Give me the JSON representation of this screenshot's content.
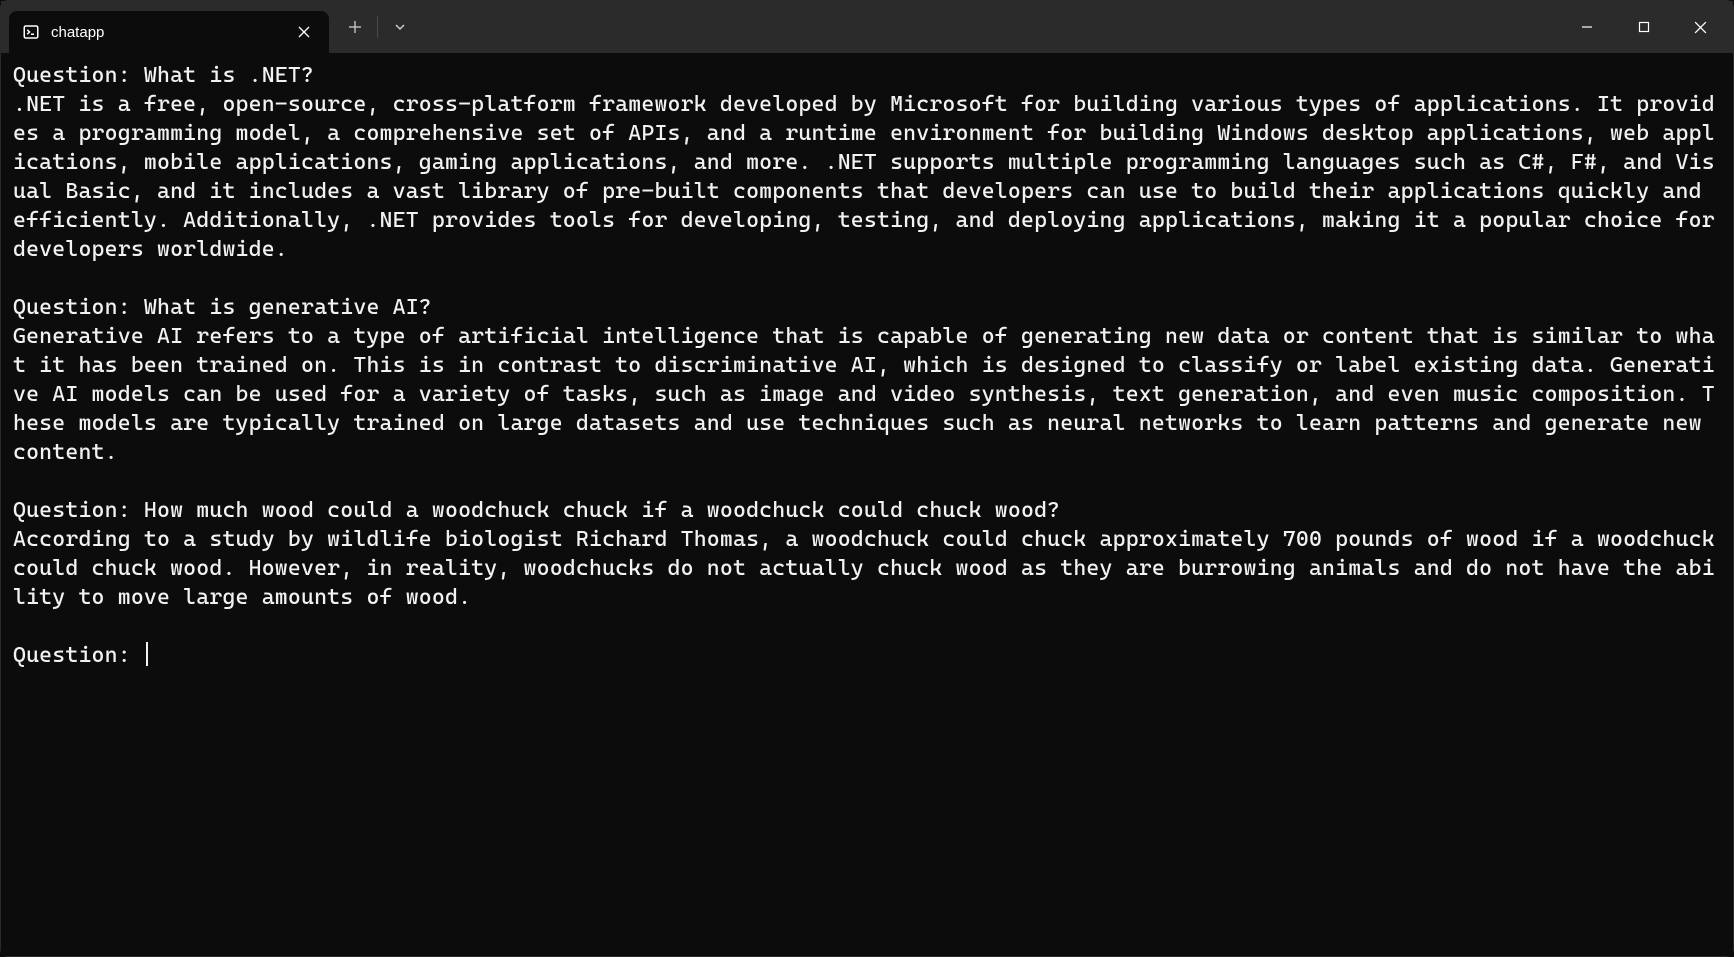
{
  "window": {
    "tab_title": "chatapp"
  },
  "terminal": {
    "qa": [
      {
        "question_label": "Question: ",
        "question": "What is .NET?",
        "answer": ".NET is a free, open-source, cross-platform framework developed by Microsoft for building various types of applications. It provides a programming model, a comprehensive set of APIs, and a runtime environment for building Windows desktop applications, web applications, mobile applications, gaming applications, and more. .NET supports multiple programming languages such as C#, F#, and Visual Basic, and it includes a vast library of pre-built components that developers can use to build their applications quickly and efficiently. Additionally, .NET provides tools for developing, testing, and deploying applications, making it a popular choice for developers worldwide."
      },
      {
        "question_label": "Question: ",
        "question": "What is generative AI?",
        "answer": "Generative AI refers to a type of artificial intelligence that is capable of generating new data or content that is similar to what it has been trained on. This is in contrast to discriminative AI, which is designed to classify or label existing data. Generative AI models can be used for a variety of tasks, such as image and video synthesis, text generation, and even music composition. These models are typically trained on large datasets and use techniques such as neural networks to learn patterns and generate new content."
      },
      {
        "question_label": "Question: ",
        "question": "How much wood could a woodchuck chuck if a woodchuck could chuck wood?",
        "answer": "According to a study by wildlife biologist Richard Thomas, a woodchuck could chuck approximately 700 pounds of wood if a woodchuck could chuck wood. However, in reality, woodchucks do not actually chuck wood as they are burrowing animals and do not have the ability to move large amounts of wood."
      }
    ],
    "prompt_label": "Question: "
  }
}
